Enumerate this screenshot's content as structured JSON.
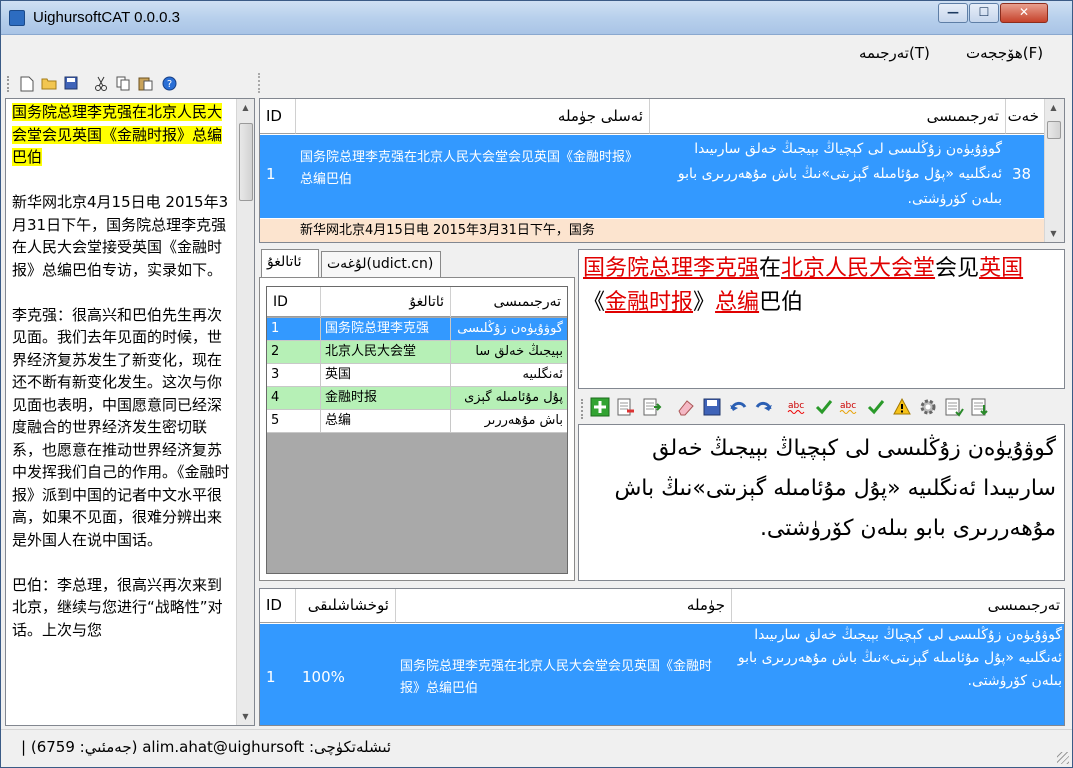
{
  "window": {
    "title": "UighursoftCAT 0.0.0.3",
    "minimize": "—",
    "maximize": "☐",
    "close": "✕"
  },
  "menu": {
    "file": "ھۆججەت(F)",
    "view": "تەرجىمە(T)"
  },
  "toolbar_icons": [
    "new-file-icon",
    "open-folder-icon",
    "save-icon",
    "cut-icon",
    "copy-icon",
    "paste-icon",
    "help-icon"
  ],
  "source_text": {
    "highlighted": "国务院总理李克强在北京人民大会堂会见英国《金融时报》总编巴伯",
    "body": "\n\n新华网北京4月15日电 2015年3月31日下午，国务院总理李克强在人民大会堂接受英国《金融时报》总编巴伯专访，实录如下。\n\n李克强：很高兴和巴伯先生再次见面。我们去年见面的时候，世界经济复苏发生了新变化，现在还不断有新变化发生。这次与你见面也表明，中国愿意同已经深度融合的世界经济发生密切联系，也愿意在推动世界经济复苏中发挥我们自己的作用。《金融时报》派到中国的记者中文水平很高，如果不见面，很难分辨出来是外国人在说中国话。\n\n巴伯：李总理，很高兴再次来到北京，继续与您进行“战略性”对话。上次与您"
  },
  "segment_grid": {
    "headers": {
      "id": "ID",
      "source": "ئەسلى جۈملە",
      "target": "تەرجىمىسى",
      "extra": "خەت"
    },
    "rows": [
      {
        "id": "1",
        "source": "国务院总理李克强在北京人民大会堂会见英国《金融时报》总编巴伯",
        "target": "گوۋۇيۈەن زۇڭلىسى لى كېچياڭ بېيجىڭ خەلق سارىيىدا ئەنگلىيە «پۇل مۇئامىلە گېزىتى»نىڭ باش مۇھەررىرى بابو بىلەن كۆرۈشتى.",
        "count": "38"
      },
      {
        "id": "",
        "source": "新华网北京4月15日电 2015年3月31日下午，国务",
        "target": "",
        "count": ""
      }
    ]
  },
  "tabs": {
    "terms": "ئاتالغۇ",
    "dict": "لۇغەت(udict.cn)"
  },
  "term_grid": {
    "headers": {
      "id": "ID",
      "term": "ئاتالغۇ",
      "translation": "تەرجىمىسى"
    },
    "rows": [
      {
        "id": "1",
        "term": "国务院总理李克强",
        "translation": "گوۋۇيۈەن زۇڭلىسى"
      },
      {
        "id": "2",
        "term": "北京人民大会堂",
        "translation": "بېيجىڭ خەلق سا"
      },
      {
        "id": "3",
        "term": "英国",
        "translation": "ئەنگلىيە"
      },
      {
        "id": "4",
        "term": "金融时报",
        "translation": "پۇل مۇئامىلە گېزى"
      },
      {
        "id": "5",
        "term": "总编",
        "translation": "باش مۇھەررىر"
      }
    ]
  },
  "source_view": {
    "t1": "国务院总理李克强",
    "p1": "在",
    "t2": "北京人民大会堂",
    "p2": "会见",
    "t3": "英国",
    "p3": "《",
    "t4": "金融时报",
    "p4": "》",
    "t5": "总编",
    "p5": "巴伯"
  },
  "edit_toolbar_icons": [
    "add-icon",
    "insert-row-icon",
    "apply-icon",
    "eraser-icon",
    "save-icon",
    "undo-icon",
    "redo-icon",
    "spell-check-icon",
    "check-icon",
    "spell-check-all-icon",
    "confirm-icon",
    "warning-icon",
    "settings-icon",
    "export-icon",
    "import-icon"
  ],
  "target_text": "گوۋۇيۈەن زۇڭلىسى لى كېچياڭ بېيجىڭ خەلق سارىيىدا ئەنگلىيە «پۇل مۇئامىلە گېزىتى»نىڭ باش مۇھەررىرى بابو بىلەن كۆرۈشتى.",
  "match_grid": {
    "headers": {
      "id": "ID",
      "similarity": "ئوخشاشلىقى",
      "sentence": "جۈملە",
      "translation": "تەرجىمىسى"
    },
    "rows": [
      {
        "id": "1",
        "similarity": "100%",
        "sentence": "国务院总理李克强在北京人民大会堂会见英国《金融时报》总编巴伯",
        "translation": "گوۋۇيۈەن زۇڭلىسى لى كېچياڭ بېيجىڭ خەلق سارىيىدا ئەنگلىيە «پۇل مۇئامىلە گېزىتى»نىڭ  باش مۇھەررىرى بابو بىلەن كۆرۈشتى."
      }
    ]
  },
  "status": {
    "text": "| (جەمئىي: 6759) alim.ahat@uighursoft :ئىشلەتكۈچى"
  }
}
